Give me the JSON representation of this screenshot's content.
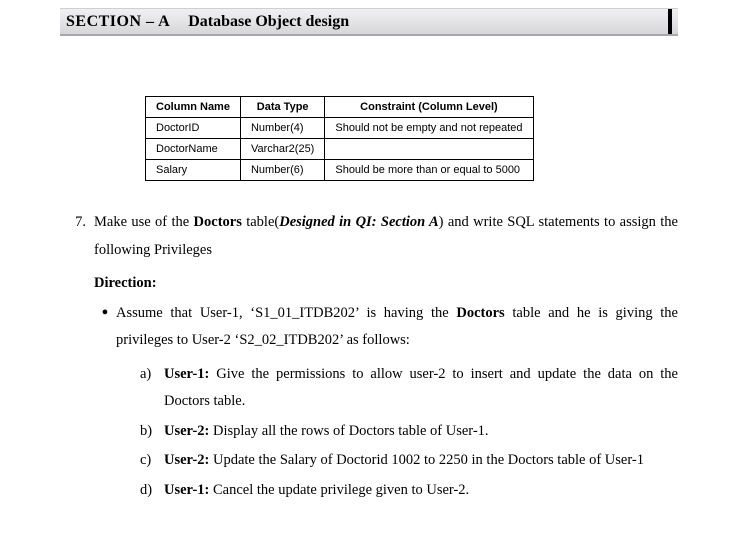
{
  "header": {
    "section_label": "SECTION – A",
    "section_title": "Database Object design"
  },
  "table": {
    "headers": [
      "Column Name",
      "Data Type",
      "Constraint  (Column Level)"
    ],
    "rows": [
      {
        "col": "DoctorID",
        "type": "Number(4)",
        "constraint": "Should not be empty and not repeated"
      },
      {
        "col": "DoctorName",
        "type": "Varchar2(25)",
        "constraint": ""
      },
      {
        "col": "Salary",
        "type": "Number(6)",
        "constraint": "Should be more than or equal to 5000"
      }
    ]
  },
  "question": {
    "number": "7.",
    "intro_pre": "Make use of the ",
    "intro_bold1": "Doctors",
    "intro_mid1": " table(",
    "intro_bi": "Designed  in QI: Section A",
    "intro_mid2": ") and write SQL statements to assign the following Privileges",
    "direction_label": "Direction:",
    "bullet_pre": "Assume that User-1, ‘S1_01_ITDB202’ is having the ",
    "bullet_bold": "Doctors",
    "bullet_post": " table and he is giving the privileges to User-2 ‘S2_02_ITDB202’ as follows:",
    "subs": [
      {
        "label": "a)",
        "bold": "User-1:",
        "text": " Give the permissions to allow user-2 to insert and update the data on the Doctors table."
      },
      {
        "label": "b)",
        "bold": "User-2:",
        "text": " Display all the rows of Doctors table of User-1."
      },
      {
        "label": "c)",
        "bold": "User-2:",
        "text": " Update the Salary of Doctorid 1002 to 2250 in the Doctors table of User-1"
      },
      {
        "label": "d)",
        "bold": "User-1:",
        "text": " Cancel the update privilege given to User-2."
      }
    ]
  }
}
